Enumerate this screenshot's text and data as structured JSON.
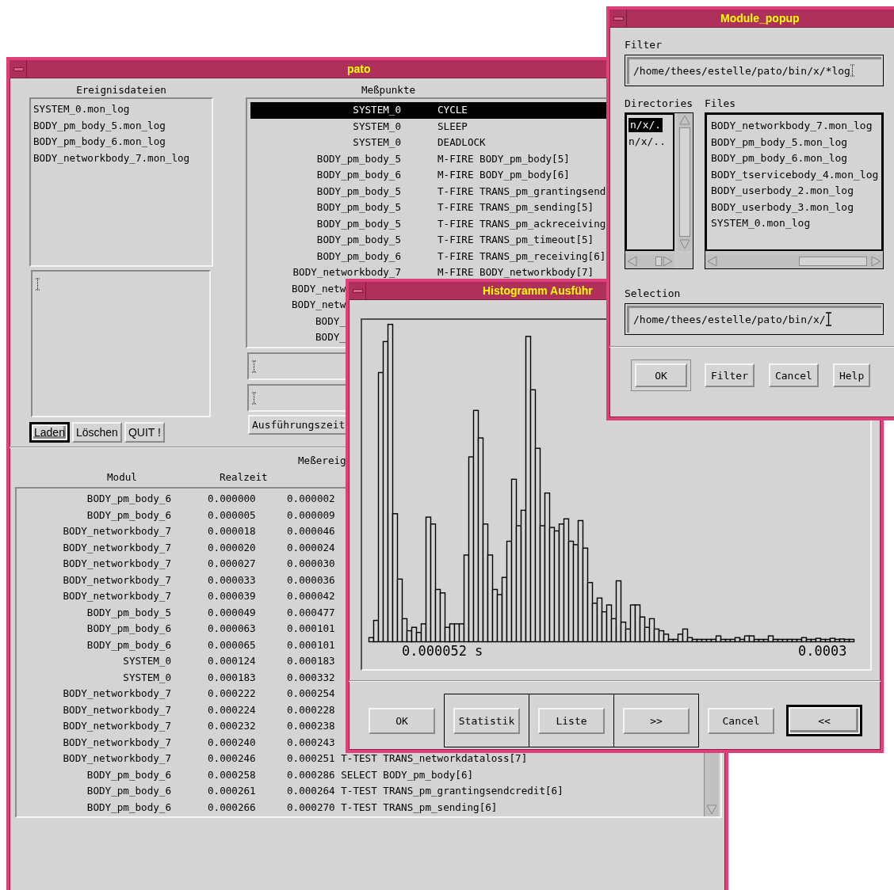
{
  "main_window": {
    "title": "pato",
    "event_files": {
      "heading": "Ereignisdateien",
      "items": [
        {
          "label": "SYSTEM_0.mon_log",
          "selected": false
        },
        {
          "label": "BODY_pm_body_5.mon_log",
          "selected": false
        },
        {
          "label": "BODY_pm_body_6.mon_log",
          "selected": false
        },
        {
          "label": "BODY_networkbody_7.mon_log",
          "selected": false
        }
      ]
    },
    "file_buttons": [
      {
        "label": "Laden",
        "default": true
      },
      {
        "label": "Löschen",
        "default": false
      },
      {
        "label": "QUIT !",
        "default": false
      }
    ],
    "measure_points": {
      "heading": "Meßpunkte",
      "rows": [
        {
          "module": "SYSTEM_0",
          "event": "CYCLE",
          "selected": true
        },
        {
          "module": "SYSTEM_0",
          "event": "SLEEP",
          "selected": false
        },
        {
          "module": "SYSTEM_0",
          "event": "DEADLOCK",
          "selected": false
        },
        {
          "module": "BODY_pm_body_5",
          "event": "M-FIRE BODY_pm_body[5]",
          "selected": false
        },
        {
          "module": "BODY_pm_body_6",
          "event": "M-FIRE BODY_pm_body[6]",
          "selected": false
        },
        {
          "module": "BODY_pm_body_5",
          "event": "T-FIRE TRANS_pm_grantingsend",
          "selected": false
        },
        {
          "module": "BODY_pm_body_5",
          "event": "T-FIRE TRANS_pm_sending[5]",
          "selected": false
        },
        {
          "module": "BODY_pm_body_5",
          "event": "T-FIRE TRANS_pm_ackreceiving",
          "selected": false
        },
        {
          "module": "BODY_pm_body_5",
          "event": "T-FIRE TRANS_pm_timeout[5]",
          "selected": false
        },
        {
          "module": "BODY_pm_body_6",
          "event": "T-FIRE TRANS_pm_receiving[6]",
          "selected": false
        },
        {
          "module": "BODY_networkbody_7",
          "event": "M-FIRE BODY_networkbody[7]",
          "selected": false
        },
        {
          "module": "BODY_netw",
          "selected": false
        },
        {
          "module": "BODY_netw",
          "selected": false
        },
        {
          "module": "BODY_",
          "selected": false
        },
        {
          "module": "BODY_",
          "selected": false
        }
      ]
    },
    "runtime_button": {
      "label": "Ausführungszeit"
    },
    "events": {
      "heading": "Meßereig",
      "columns": [
        "Modul",
        "Realzeit"
      ],
      "rows": [
        {
          "module": "BODY_pm_body_6",
          "realtime": "0.000000",
          "column_3": "0.000002"
        },
        {
          "module": "BODY_pm_body_6",
          "realtime": "0.000005",
          "column_3": "0.000009"
        },
        {
          "module": "BODY_networkbody_7",
          "realtime": "0.000018",
          "column_3": "0.000046"
        },
        {
          "module": "BODY_networkbody_7",
          "realtime": "0.000020",
          "column_3": "0.000024"
        },
        {
          "module": "BODY_networkbody_7",
          "realtime": "0.000027",
          "column_3": "0.000030"
        },
        {
          "module": "BODY_networkbody_7",
          "realtime": "0.000033",
          "column_3": "0.000036"
        },
        {
          "module": "BODY_networkbody_7",
          "realtime": "0.000039",
          "column_3": "0.000042"
        },
        {
          "module": "BODY_pm_body_5",
          "realtime": "0.000049",
          "column_3": "0.000477"
        },
        {
          "module": "BODY_pm_body_6",
          "realtime": "0.000063",
          "column_3": "0.000101"
        },
        {
          "module": "BODY_pm_body_6",
          "realtime": "0.000065",
          "column_3": "0.000101"
        },
        {
          "module": "SYSTEM_0",
          "realtime": "0.000124",
          "column_3": "0.000183"
        },
        {
          "module": "SYSTEM_0",
          "realtime": "0.000183",
          "column_3": "0.000332"
        },
        {
          "module": "BODY_networkbody_7",
          "realtime": "0.000222",
          "column_3": "0.000254"
        },
        {
          "module": "BODY_networkbody_7",
          "realtime": "0.000224",
          "column_3": "0.000228"
        },
        {
          "module": "BODY_networkbody_7",
          "realtime": "0.000232",
          "column_3": "0.000238"
        },
        {
          "module": "BODY_networkbody_7",
          "realtime": "0.000240",
          "column_3": "0.000243"
        },
        {
          "module": "BODY_networkbody_7",
          "realtime": "0.000246",
          "column_3": "0.000251 T-TEST TRANS_networkdataloss[7]"
        },
        {
          "module": "BODY_pm_body_6",
          "realtime": "0.000258",
          "column_3": "0.000286 SELECT BODY_pm_body[6]"
        },
        {
          "module": "BODY_pm_body_6",
          "realtime": "0.000261",
          "column_3": "0.000264 T-TEST TRANS_pm_grantingsendcredit[6]"
        },
        {
          "module": "BODY_pm_body_6",
          "realtime": "0.000266",
          "column_3": "0.000270 T-TEST TRANS_pm_sending[6]"
        }
      ]
    }
  },
  "histogram_window": {
    "title": "Histogramm Ausführ",
    "x_labels": [
      "0.000052 s",
      "0.0003"
    ],
    "leading_buttons": [
      {
        "label": "OK",
        "default": false
      }
    ],
    "button_group": [
      {
        "label": "Statistik",
        "default": false
      },
      {
        "label": "Liste",
        "default": false
      },
      {
        "label": ">>",
        "default": false
      }
    ],
    "trailing_buttons": [
      {
        "label": "Cancel",
        "default": false
      },
      {
        "label": "<<",
        "default": true
      }
    ]
  },
  "file_dialog": {
    "title": "Module_popup",
    "filter_label": "Filter",
    "filter_value": "/home/thees/estelle/pato/bin/x/*log",
    "directories_label": "Directories",
    "directories": [
      {
        "label": "n/x/.",
        "selected": true
      },
      {
        "label": "n/x/..",
        "selected": false
      }
    ],
    "files_label": "Files",
    "files": [
      {
        "label": "BODY_networkbody_7.mon_log",
        "selected": false
      },
      {
        "label": "BODY_pm_body_5.mon_log",
        "selected": false
      },
      {
        "label": "BODY_pm_body_6.mon_log",
        "selected": false
      },
      {
        "label": "BODY_tservicebody_4.mon_log",
        "selected": false
      },
      {
        "label": "BODY_userbody_2.mon_log",
        "selected": false
      },
      {
        "label": "BODY_userbody_3.mon_log",
        "selected": false
      },
      {
        "label": "SYSTEM_0.mon_log",
        "selected": false
      }
    ],
    "selection_label": "Selection",
    "selection_value": "/home/thees/estelle/pato/bin/x/",
    "buttons": [
      {
        "label": "OK",
        "default": true
      },
      {
        "label": "Filter",
        "default": false
      },
      {
        "label": "Cancel",
        "default": false
      },
      {
        "label": "Help",
        "default": false
      }
    ]
  }
}
